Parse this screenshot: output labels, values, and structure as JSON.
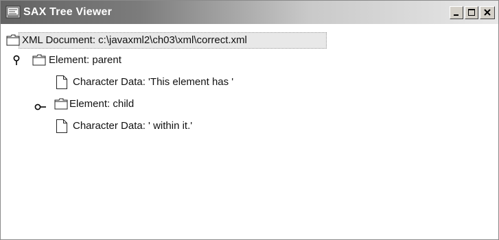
{
  "window": {
    "title": "SAX Tree Viewer",
    "controls": [
      "minimize",
      "maximize",
      "close"
    ]
  },
  "tree": {
    "root": {
      "label": "XML Document: c:\\javaxml2\\ch03\\xml\\correct.xml",
      "icon": "folder-icon",
      "selected": true
    },
    "nodes": [
      {
        "label": "Element: parent",
        "icon": "folder-icon",
        "handle": "expanded"
      },
      {
        "label": "Character Data: 'This element has '",
        "icon": "document-icon"
      },
      {
        "label": "Element: child",
        "icon": "folder-icon",
        "handle": "collapsed"
      },
      {
        "label": "Character Data: ' within it.'",
        "icon": "document-icon"
      }
    ]
  },
  "colors": {
    "titlebar_dark": "#636363",
    "titlebar_light": "#e8e8e8",
    "title_text": "#ffffff",
    "selection": "#e8e8e8"
  }
}
